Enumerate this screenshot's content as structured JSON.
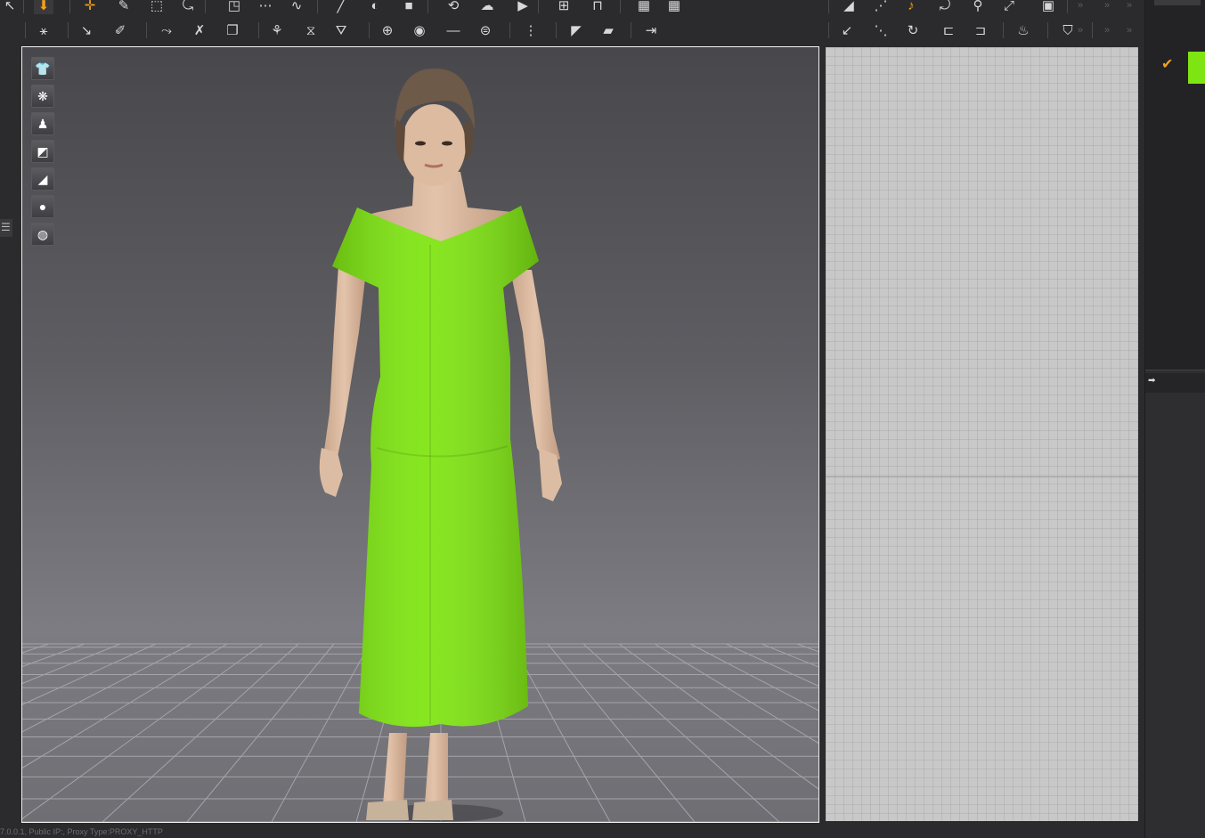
{
  "toolbar_top": {
    "tools": [
      {
        "icon": "back-arrow-icon",
        "glyph": "↖"
      },
      {
        "icon": "arrow-down-icon",
        "glyph": "⬇",
        "accent": true,
        "selected": true
      },
      {
        "icon": "move-cross-icon",
        "glyph": "✛",
        "accent": true
      },
      {
        "icon": "edit-pattern-icon",
        "glyph": "✎"
      },
      {
        "icon": "transform-icon",
        "glyph": "⬚"
      },
      {
        "icon": "edit-curve-icon",
        "glyph": "⤿"
      },
      {
        "icon": "add-point-icon",
        "glyph": "◳"
      },
      {
        "icon": "segment-icon",
        "glyph": "⋯"
      },
      {
        "icon": "curve-point-icon",
        "glyph": "∿"
      },
      {
        "icon": "line-icon",
        "glyph": "╱"
      },
      {
        "icon": "dart-icon",
        "glyph": "◐"
      },
      {
        "icon": "fill-icon",
        "glyph": "■"
      },
      {
        "icon": "sewing-icon",
        "glyph": "⟲"
      },
      {
        "icon": "cloud-icon",
        "glyph": "☁"
      },
      {
        "icon": "play-icon",
        "glyph": "▶"
      },
      {
        "icon": "grid-add-icon",
        "glyph": "⊞"
      },
      {
        "icon": "gift-icon",
        "glyph": "⊓"
      },
      {
        "icon": "mesh-icon",
        "glyph": "▦"
      },
      {
        "icon": "mesh-2-icon",
        "glyph": "▦"
      },
      {
        "icon": "fold-icon",
        "glyph": "◢"
      },
      {
        "icon": "seam-icon",
        "glyph": "⋰"
      },
      {
        "icon": "free-sew-icon",
        "glyph": "♪",
        "accent": true
      },
      {
        "icon": "tack-icon",
        "glyph": "⤾"
      },
      {
        "icon": "pin-icon",
        "glyph": "⚲"
      },
      {
        "icon": "measure-icon",
        "glyph": "⤢"
      },
      {
        "icon": "box-icon",
        "glyph": "▣"
      }
    ]
  },
  "toolbar_2": {
    "tools": [
      {
        "icon": "walk-pose-icon",
        "glyph": "⚹"
      },
      {
        "icon": "select-arrangement-icon",
        "glyph": "↘"
      },
      {
        "icon": "arrangement-point-icon",
        "glyph": "✐"
      },
      {
        "icon": "fold-arrange-icon",
        "glyph": "⤳"
      },
      {
        "icon": "tuck-icon",
        "glyph": "✗"
      },
      {
        "icon": "flatten-icon",
        "glyph": "❐"
      },
      {
        "icon": "pin-avatar-icon",
        "glyph": "⚘"
      },
      {
        "icon": "select-mesh-icon",
        "glyph": "⧖"
      },
      {
        "icon": "shirt-texture-icon",
        "glyph": "⛛"
      },
      {
        "icon": "button-icon",
        "glyph": "⊕"
      },
      {
        "icon": "button-round-icon",
        "glyph": "◉"
      },
      {
        "icon": "topstitch-icon",
        "glyph": "—"
      },
      {
        "icon": "lock-icon",
        "glyph": "⊜"
      },
      {
        "icon": "zipper-icon",
        "glyph": "⋮"
      },
      {
        "icon": "select-trim-icon",
        "glyph": "◤"
      },
      {
        "icon": "trim-icon",
        "glyph": "▰"
      },
      {
        "icon": "measure-arrow-icon",
        "glyph": "⇥"
      },
      {
        "icon": "pattern-select-icon",
        "glyph": "↙"
      },
      {
        "icon": "pattern-seg-icon",
        "glyph": "⋱"
      },
      {
        "icon": "pattern-sew-icon",
        "glyph": "↻"
      },
      {
        "icon": "pattern-edit-icon",
        "glyph": "⊏"
      },
      {
        "icon": "pattern-pin-icon",
        "glyph": "⊐"
      },
      {
        "icon": "iron-icon",
        "glyph": "♨"
      },
      {
        "icon": "shirt-select-icon",
        "glyph": "⛉"
      }
    ]
  },
  "viewport_tools": [
    {
      "icon": "garment-display-icon",
      "glyph": "👕"
    },
    {
      "icon": "texture-display-icon",
      "glyph": "❋"
    },
    {
      "icon": "avatar-display-icon",
      "glyph": "♟"
    },
    {
      "icon": "fabric-surface-icon",
      "glyph": "◩"
    },
    {
      "icon": "thickness-icon",
      "glyph": "◢"
    },
    {
      "icon": "avatar-skin-icon",
      "glyph": "●"
    },
    {
      "icon": "environment-sphere-icon",
      "glyph": "◍"
    }
  ],
  "garment_color": "#7fe512",
  "status_text": "7.0.0.1, Public IP:, Proxy Type:PROXY_HTTP"
}
